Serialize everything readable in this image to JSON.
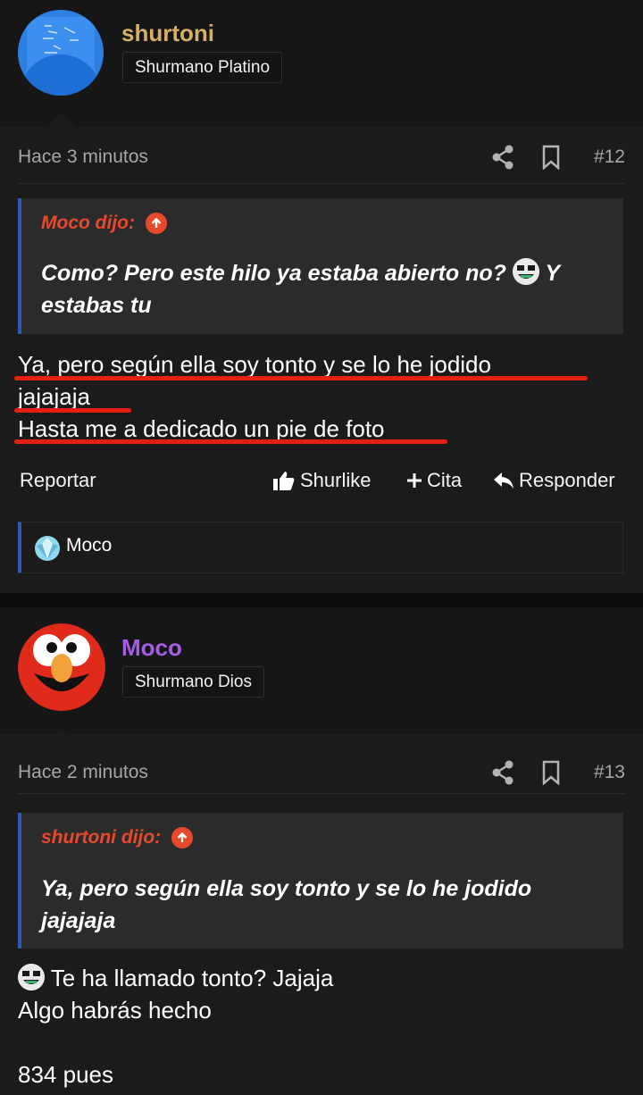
{
  "posts": [
    {
      "username": "shurtoni",
      "username_color": "#d6b064",
      "rank": "Shurmano Platino",
      "avatar": "whiteboard-photo",
      "time": "Hace 3 minutos",
      "post_number": "#12",
      "quote": {
        "author": "Moco dijo:",
        "text_1": "Como? Pero este hilo ya estaba abierto no?",
        "emoji": "laughing-emoji",
        "text_2": "Y estabas tu"
      },
      "body_lines": [
        "Ya, pero según ella soy tonto y se lo he jodido",
        "jajajaja",
        "Hasta me a dedicado un pie de foto"
      ],
      "actions": {
        "report": "Reportar",
        "like": "Shurlike",
        "quote": "Cita",
        "reply": "Responder"
      },
      "liked_by": "Moco"
    },
    {
      "username": "Moco",
      "username_color": "#a55de8",
      "rank": "Shurmano Dios",
      "avatar": "elmo-avatar",
      "time": "Hace 2 minutos",
      "post_number": "#13",
      "quote": {
        "author": "shurtoni dijo:",
        "text": "Ya, pero según ella soy tonto y se lo he jodido jajajaja"
      },
      "body_lines": [
        "Te ha llamado tonto? Jajaja",
        "Algo habrás hecho",
        "834 pues"
      ],
      "body_emoji": "laughing-emoji"
    }
  ],
  "colors": {
    "accent_quote_author": "#e8492c",
    "quote_border": "#2a5bb0",
    "underline_markup": "#e21f12"
  }
}
